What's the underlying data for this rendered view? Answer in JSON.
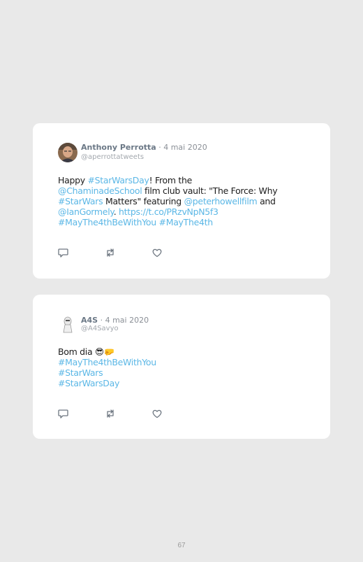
{
  "tweets": [
    {
      "author": "Anthony Perrotta",
      "separator": "·",
      "date": "4 mai 2020",
      "handle": "@aperrottatweets",
      "body": {
        "t0": "Happy ",
        "l0": "#StarWarsDay",
        "t1": "! From the",
        "l1": "@ChaminadeSchool",
        "t2": " film club vault: \"The Force: Why",
        "l2": "#StarWars",
        "t3": " Matters\" featuring ",
        "l3": "@peterhowellfilm",
        "t4": " and",
        "l4": "@IanGormely",
        "t5": ". ",
        "l5": "https://t.co/PRzvNpN5f3",
        "l6": "#MayThe4thBeWithYou",
        "t6": " ",
        "l7": "#MayThe4th"
      },
      "actions": [
        "reply-icon",
        "retweet-icon",
        "like-icon"
      ]
    },
    {
      "author": "A4S",
      "separator": "·",
      "date": "4 mai 2020",
      "handle": "@A4Savyo",
      "body": {
        "t0": "Bom dia ",
        "emoji": "😎🤛",
        "l0": "#MayThe4thBeWithYou",
        "l1": "#StarWars",
        "l2": "#StarWarsDay"
      },
      "actions": [
        "reply-icon",
        "retweet-icon",
        "like-icon"
      ]
    }
  ],
  "page_number": "67",
  "colors": {
    "background": "#e9e9e9",
    "card": "#ffffff",
    "link": "#5bb7e6",
    "text": "#1c1c1c",
    "muted": "#a3a8ae",
    "author": "#6b7886"
  }
}
